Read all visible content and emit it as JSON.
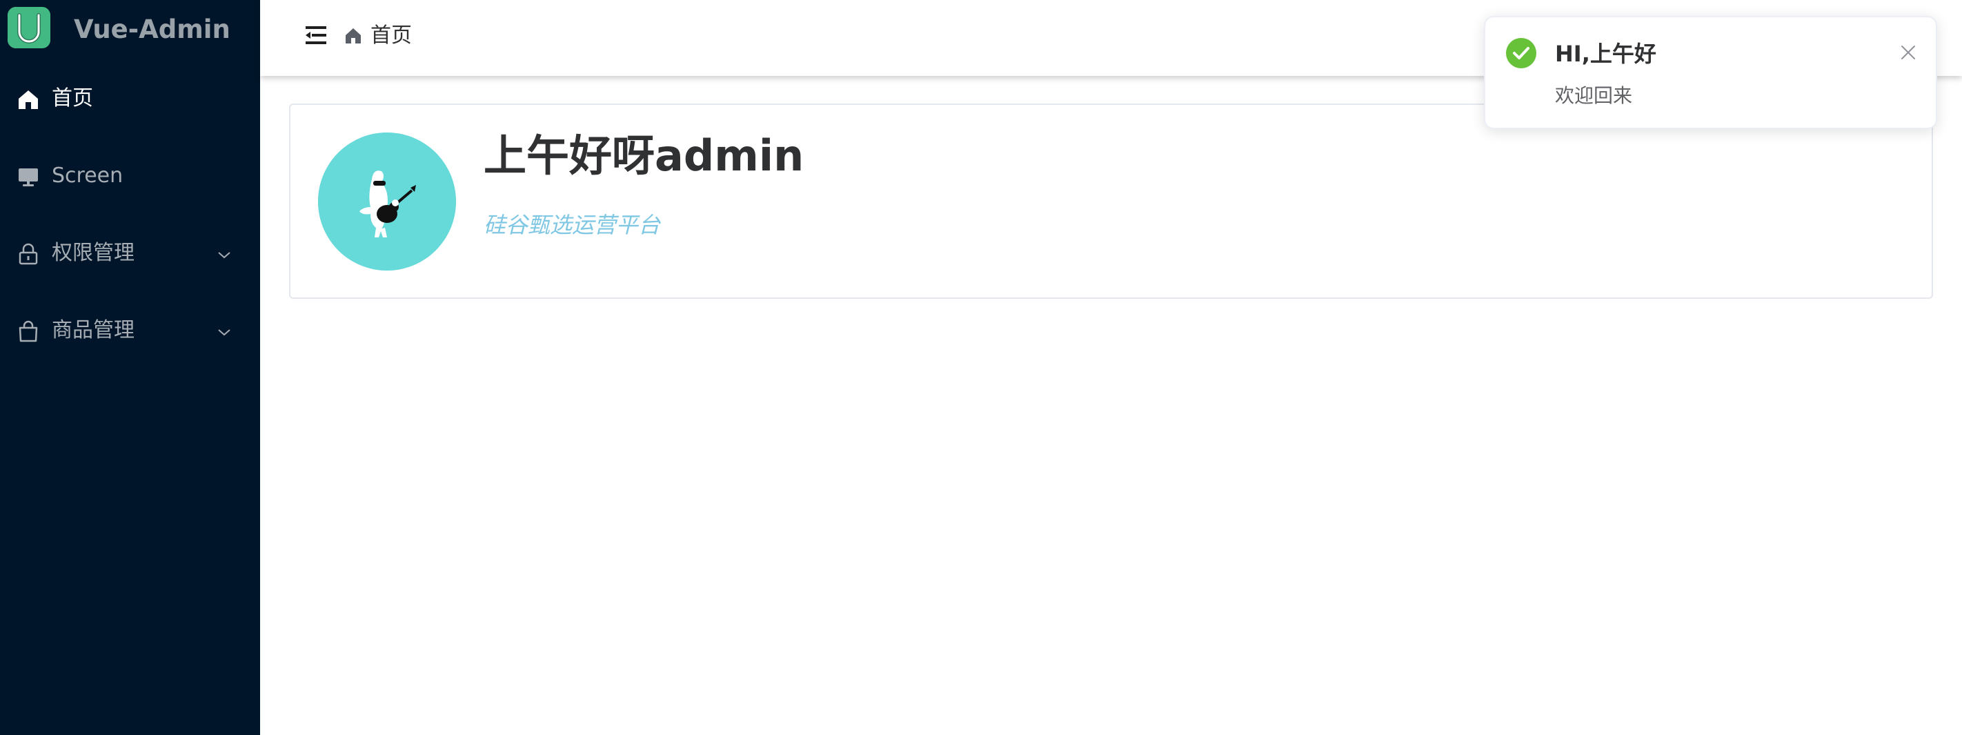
{
  "sidebar": {
    "brand": {
      "title": "Vue-Admin",
      "logo_icon": "vue-logo-icon"
    },
    "items": [
      {
        "label": "首页",
        "icon": "home-icon",
        "active": true,
        "has_submenu": false
      },
      {
        "label": "Screen",
        "icon": "monitor-icon",
        "active": false,
        "has_submenu": false
      },
      {
        "label": "权限管理",
        "icon": "lock-icon",
        "active": false,
        "has_submenu": true
      },
      {
        "label": "商品管理",
        "icon": "shopping-bag-icon",
        "active": false,
        "has_submenu": true
      }
    ]
  },
  "header": {
    "fold_icon": "fold-menu-icon",
    "breadcrumb": {
      "icon": "home-icon",
      "label": "首页"
    }
  },
  "welcome_card": {
    "greeting": "上午好呀admin",
    "subtitle": "硅谷甄选运营平台",
    "avatar_icon": "guitar-character-avatar"
  },
  "notification": {
    "type": "success",
    "title": "HI,上午好",
    "message": "欢迎回来",
    "icon": "check-circle-icon",
    "close_icon": "close-icon"
  },
  "colors": {
    "sidebar_bg": "#001529",
    "menu_text": "#a6adb4",
    "menu_text_active": "#ffffff",
    "avatar_bg": "#66d9d9",
    "subtitle_text": "#7fc7e3",
    "success": "#67c23a",
    "brand_logo": "#42b983"
  }
}
